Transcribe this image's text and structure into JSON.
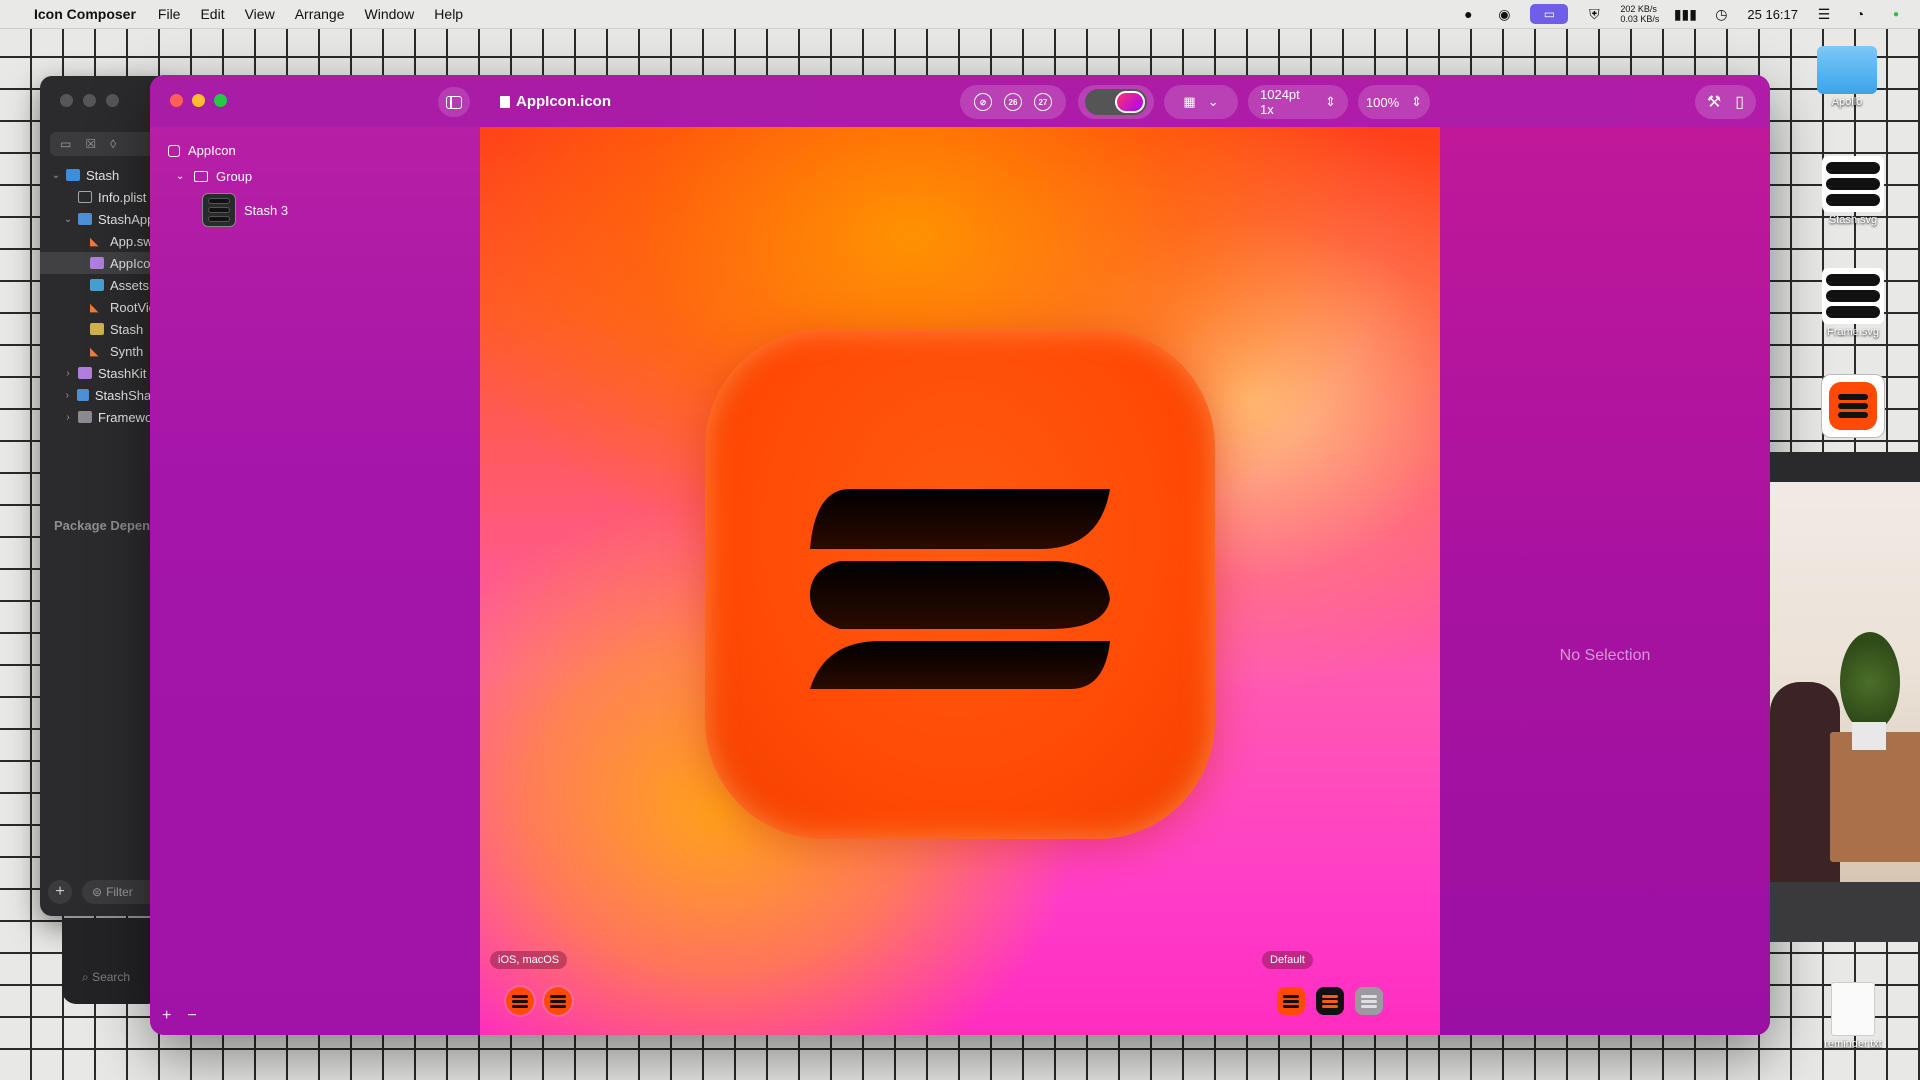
{
  "menubar": {
    "app_name": "Icon Composer",
    "menus": [
      "File",
      "Edit",
      "View",
      "Arrange",
      "Window",
      "Help"
    ],
    "net_up": "202 KB/s",
    "net_down": "0.03 KB/s",
    "clock": "25 16:17"
  },
  "bg_window": {
    "tree": [
      {
        "label": "Stash",
        "depth": 0,
        "icon": "project",
        "expanded": true
      },
      {
        "label": "Info.plist",
        "depth": 1,
        "icon": "plist"
      },
      {
        "label": "StashApp",
        "depth": 1,
        "icon": "folder",
        "expanded": true
      },
      {
        "label": "App.swift",
        "depth": 2,
        "icon": "swift"
      },
      {
        "label": "AppIcon",
        "depth": 2,
        "icon": "pkg",
        "selected": true
      },
      {
        "label": "Assets",
        "depth": 2,
        "icon": "asset"
      },
      {
        "label": "RootView",
        "depth": 2,
        "icon": "swift"
      },
      {
        "label": "Stash",
        "depth": 2,
        "icon": "yellow"
      },
      {
        "label": "Synth",
        "depth": 2,
        "icon": "swift"
      },
      {
        "label": "StashKit",
        "depth": 1,
        "icon": "pkg",
        "expanded": false
      },
      {
        "label": "StashShared",
        "depth": 1,
        "icon": "folder",
        "expanded": false
      },
      {
        "label": "Frameworks",
        "depth": 1,
        "icon": "folder-g",
        "expanded": false
      }
    ],
    "package_dependencies": "Package Dependencies",
    "filter_placeholder": "Filter",
    "search_placeholder": "Search"
  },
  "window": {
    "document_title": "AppIcon.icon",
    "toolbar": {
      "render_mode_none": "⊘",
      "ios26": "26",
      "ios27": "27",
      "size_label": "1024pt 1x",
      "zoom_label": "100%"
    },
    "sidebar": {
      "root": "AppIcon",
      "group": "Group",
      "layer": "Stash 3",
      "add": "+",
      "remove": "−"
    },
    "canvas": {
      "platform_label": "iOS, macOS",
      "variant_label": "Default"
    },
    "inspector": {
      "empty_text": "No Selection"
    }
  },
  "desktop": {
    "items": [
      "Apollo",
      "Stash.svg",
      "Frame.svg",
      "",
      "reminder.txt"
    ]
  },
  "colors": {
    "accent_orange": "#ff4a05",
    "window_magenta": "#a815a8"
  }
}
